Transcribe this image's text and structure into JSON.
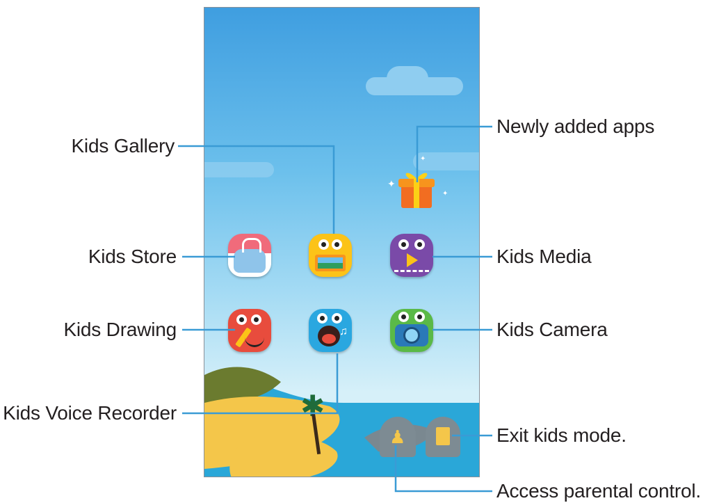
{
  "labels": {
    "newly_added_apps": "Newly added apps",
    "kids_gallery": "Kids Gallery",
    "kids_store": "Kids Store",
    "kids_media": "Kids Media",
    "kids_drawing": "Kids Drawing",
    "kids_camera": "Kids Camera",
    "kids_voice_recorder": "Kids Voice Recorder",
    "exit_kids_mode": "Exit kids mode.",
    "access_parental_control": "Access parental control."
  },
  "icons": {
    "kids_store": "shopping-bag-hippo-icon",
    "kids_gallery": "gallery-owl-icon",
    "kids_media": "media-play-icon",
    "kids_drawing": "pencil-drawing-icon",
    "kids_voice_recorder": "voice-recorder-icon",
    "kids_camera": "camera-frog-icon",
    "newly_added_apps": "gift-box-icon",
    "parental_control": "parent-child-rock-icon",
    "exit_kids_mode": "exit-door-rock-icon"
  },
  "colors": {
    "callout_line": "#3a9bd5",
    "sky": "#6cc0ec",
    "sea": "#2aa7d8",
    "sand": "#f4c64a"
  }
}
